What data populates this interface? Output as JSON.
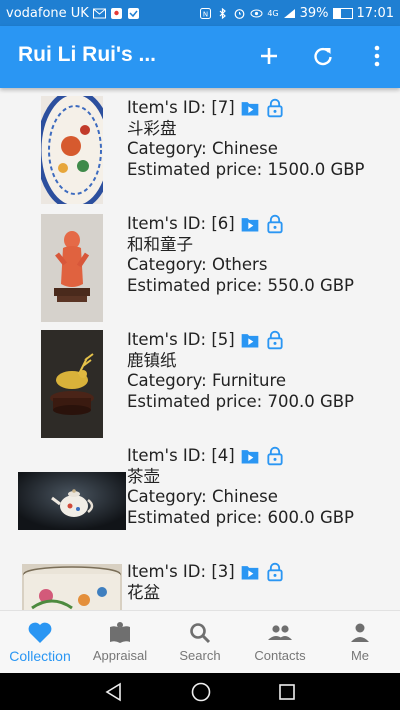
{
  "status": {
    "carrier": "vodafone UK",
    "battery_text": "39%",
    "battery_level": 0.39,
    "time": "17:01",
    "network": "4G"
  },
  "app": {
    "title": "Rui Li Rui's ...",
    "accent": "#2a96f3",
    "actions": [
      "add-icon",
      "refresh-icon",
      "more-vert-icon"
    ]
  },
  "items": [
    {
      "id": "Item's ID: [7]",
      "name": "斗彩盘",
      "category": "Category: Chinese",
      "price": "Estimated price: 1500.0 GBP"
    },
    {
      "id": "Item's ID: [6]",
      "name": "和和童子",
      "category": "Category: Others",
      "price": "Estimated price: 550.0 GBP"
    },
    {
      "id": "Item's ID: [5]",
      "name": "鹿镇纸",
      "category": "Category: Furniture",
      "price": "Estimated price: 700.0 GBP"
    },
    {
      "id": "Item's ID: [4]",
      "name": "茶壶",
      "category": "Category: Chinese",
      "price": "Estimated price: 600.0 GBP"
    },
    {
      "id": "Item's ID: [3]",
      "name": "花盆",
      "category": "",
      "price": ""
    }
  ],
  "nav": [
    {
      "label": "Collection",
      "icon": "heart-icon",
      "active": true
    },
    {
      "label": "Appraisal",
      "icon": "book-icon",
      "active": false
    },
    {
      "label": "Search",
      "icon": "search-icon",
      "active": false
    },
    {
      "label": "Contacts",
      "icon": "contacts-icon",
      "active": false
    },
    {
      "label": "Me",
      "icon": "person-icon",
      "active": false
    }
  ]
}
